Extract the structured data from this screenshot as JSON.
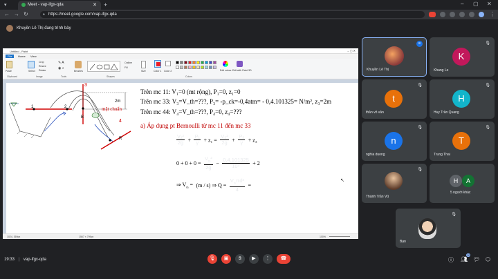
{
  "browser": {
    "tab_title": "Meet - vap-ifgx-qda",
    "url": "https://meet.google.com/vap-ifgx-qda"
  },
  "presenter_bar": {
    "text": "Khuyền Lê Thị đang trình bày"
  },
  "paint": {
    "title": "Untitled - Paint",
    "menu": [
      "File",
      "Home",
      "View"
    ],
    "ribbon_labels": [
      "Clipboard",
      "Image",
      "Tools",
      "Shapes",
      "Colors"
    ],
    "tool_labels": {
      "paste": "Paste",
      "crop": "Crop",
      "resize": "Resize",
      "rotate": "Rotate",
      "select": "Select",
      "brushes": "Brushes",
      "size": "Size",
      "color1": "Color 1",
      "color2": "Color 2",
      "edit_colors": "Edit colors",
      "edit_paint3d": "Edit with Paint 3D",
      "outline": "Outline",
      "fill": "Fill"
    },
    "status": {
      "position": "1024, 369px",
      "size": "1567 × 799px",
      "zoom": "100%"
    },
    "palette": [
      "#000000",
      "#7f7f7f",
      "#880015",
      "#ed1c24",
      "#ff7f27",
      "#fff200",
      "#22b14c",
      "#00a2e8",
      "#3f48cc",
      "#a349a4",
      "#ffffff",
      "#c3c3c3",
      "#b97a57",
      "#ffaec9",
      "#ffc90e",
      "#efe4b0",
      "#b5e61d",
      "#99d9ea",
      "#7092be",
      "#c8bfe7"
    ]
  },
  "diagram": {
    "labels": {
      "n1": "1",
      "n2": "2",
      "n3": "3",
      "n4": "4",
      "b": "B",
      "r": "R",
      "height": "2m",
      "surface": "mặt chuẩn"
    }
  },
  "equations": {
    "line1": "Trên mc 11: V₁=0 (mt rộng), P₁=0, z₁=0",
    "line2": "Trên mc 33: V₃=V_th=???, P₃= -p_ck=-0,4atm= - 0,4.101325= N/m², z₃=2m",
    "line3": "Trên mc 44: V₄=V_th=???, P₄=0, z₄=???",
    "heading": "a) Áp dụng pt Bernoulli từ mc 11 đến mc 33"
  },
  "participants": [
    {
      "name": "Khuyền Lê Thị",
      "initial": "",
      "color": "#3c4043",
      "muted": false
    },
    {
      "name": "Khang Le",
      "initial": "K",
      "color": "#c2185b",
      "muted": true
    },
    {
      "name": "thân vô vân",
      "initial": "t",
      "color": "#e8710a",
      "muted": true
    },
    {
      "name": "Huy Trần Quang",
      "initial": "H",
      "color": "#12b5cb",
      "muted": true
    },
    {
      "name": "nghia duong",
      "initial": "n",
      "color": "#1a73e8",
      "muted": true
    },
    {
      "name": "Trung Thai",
      "initial": "T",
      "color": "#e8710a",
      "muted": true
    },
    {
      "name": "Thành Trần Vũ",
      "initial": "",
      "color": "#3c4043",
      "muted": true
    },
    {
      "name": "5 người khác",
      "initial": "",
      "color": "#3c4043",
      "muted": false
    },
    {
      "name": "Bạn",
      "initial": "",
      "color": "#3c4043",
      "muted": true
    }
  ],
  "others_avatars": [
    "H",
    "A"
  ],
  "bottom": {
    "time": "19:33",
    "meeting_code": "vap-ifgx-qda",
    "people_count": "10"
  }
}
